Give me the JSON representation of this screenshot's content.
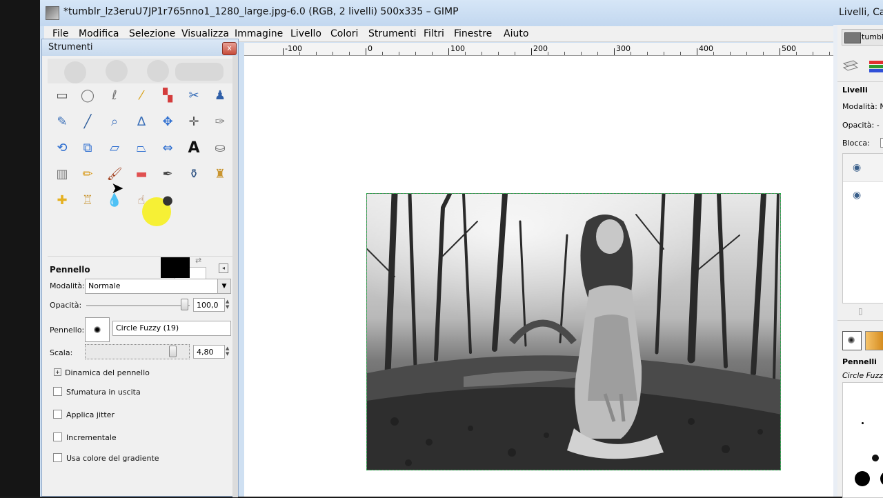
{
  "main_window": {
    "title": "*tumblr_lz3eruU7JP1r765nno1_1280_large.jpg-6.0 (RGB, 2 livelli) 500x335 – GIMP",
    "menu": [
      "File",
      "Modifica",
      "Selezione",
      "Visualizza",
      "Immagine",
      "Livello",
      "Colori",
      "Strumenti",
      "Filtri",
      "Finestre",
      "Aiuto"
    ],
    "ruler_labels": [
      "-100",
      "0",
      "100",
      "200",
      "300",
      "400",
      "500"
    ]
  },
  "toolbox": {
    "title": "Strumenti",
    "close_label": "x",
    "tools": [
      "rect-select-icon",
      "ellipse-select-icon",
      "free-select-icon",
      "fuzzy-select-icon",
      "select-by-color-icon",
      "scissors-icon",
      "foreground-select-icon",
      "paths-icon",
      "color-picker-icon",
      "zoom-icon",
      "measure-icon",
      "move-icon",
      "align-icon",
      "crop-icon",
      "rotate-icon",
      "scale-icon",
      "shear-icon",
      "perspective-icon",
      "flip-icon",
      "text-icon",
      "bucket-fill-icon",
      "blend-icon",
      "pencil-icon",
      "paintbrush-icon",
      "eraser-icon",
      "airbrush-icon",
      "ink-icon",
      "clone-icon",
      "heal-icon",
      "perspective-clone-icon",
      "blur-icon",
      "smudge-icon",
      "dodge-burn-icon"
    ]
  },
  "tool_options": {
    "tool_name": "Pennello",
    "mode_label": "Modalità:",
    "mode_value": "Normale",
    "opacity_label": "Opacità:",
    "opacity_value": "100,0",
    "brush_label": "Pennello:",
    "brush_value": "Circle Fuzzy (19)",
    "scale_label": "Scala:",
    "scale_value": "4,80",
    "dynamics_label": "Dinamica del pennello",
    "checkboxes": [
      "Sfumatura in uscita",
      "Applica jitter",
      "Incrementale",
      "Usa colore del gradiente"
    ]
  },
  "right_dock": {
    "title": "Livelli, Can",
    "tab_label": "tumblr_",
    "layers_heading": "Livelli",
    "mode_label": "Modalità: N",
    "opacity_label": "Opacità: -",
    "lock_label": "Blocca:",
    "brushes_heading": "Pennelli",
    "brush_name": "Circle Fuzz"
  },
  "colors": {
    "foreground": "#000000",
    "background": "#ffffff",
    "selection_border": "#2aa84a",
    "cursor_highlight": "#f5ef2a"
  }
}
